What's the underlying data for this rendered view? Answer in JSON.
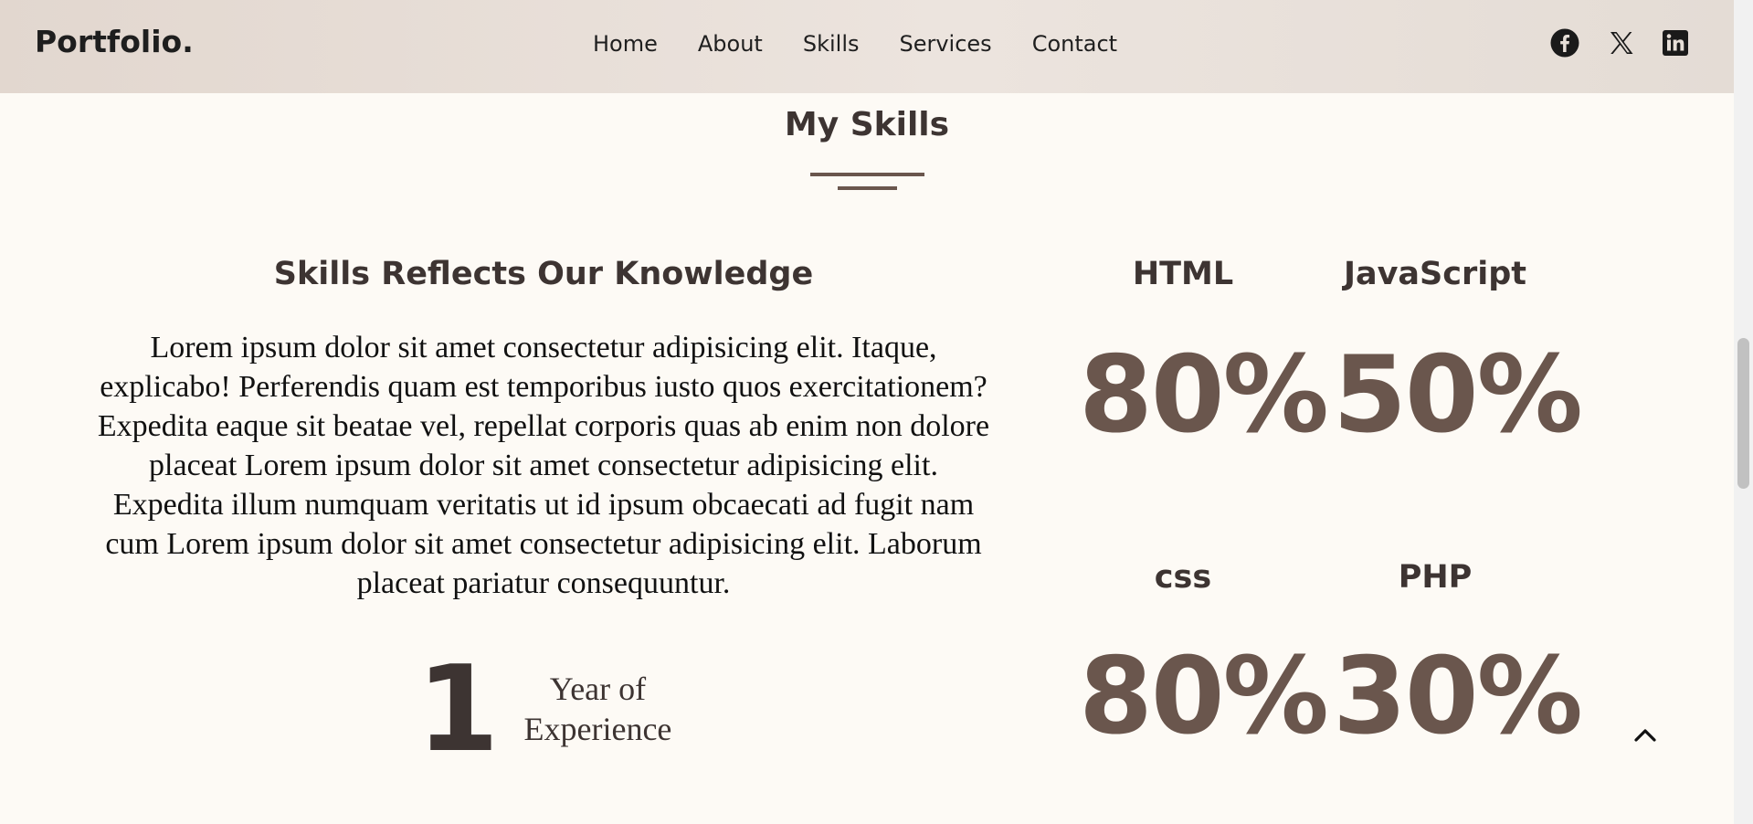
{
  "header": {
    "logo": "Portfolio.",
    "nav": [
      "Home",
      "About",
      "Skills",
      "Services",
      "Contact"
    ],
    "social_icons": [
      "facebook-icon",
      "x-icon",
      "linkedin-icon"
    ]
  },
  "skills_section": {
    "title": "My Skills",
    "subtitle": "Skills Reflects Our Knowledge",
    "paragraph": "Lorem ipsum dolor sit amet consectetur adipisicing elit. Itaque, explicabo! Perferendis quam est temporibus iusto quos exercitationem? Expedita eaque sit beatae vel, repellat corporis quas ab enim non dolore placeat Lorem ipsum dolor sit amet consectetur adipisicing elit. Expedita illum numquam veritatis ut id ipsum obcaecati ad fugit nam cum Lorem ipsum dolor sit amet consectetur adipisicing elit. Laborum placeat pariatur consequuntur.",
    "experience": {
      "number": "1",
      "label": "Year of Experience"
    },
    "skills": [
      {
        "name": "HTML",
        "percent": "80%"
      },
      {
        "name": "JavaScript",
        "percent": "50%"
      },
      {
        "name": "css",
        "percent": "80%"
      },
      {
        "name": "PHP",
        "percent": "30%"
      }
    ]
  },
  "scroll_top_icon": "chevron-up-icon",
  "colors": {
    "header_bg": "#e6ddd6",
    "page_bg": "#fdfaf5",
    "accent": "#6a564d",
    "heading": "#3d3432"
  }
}
